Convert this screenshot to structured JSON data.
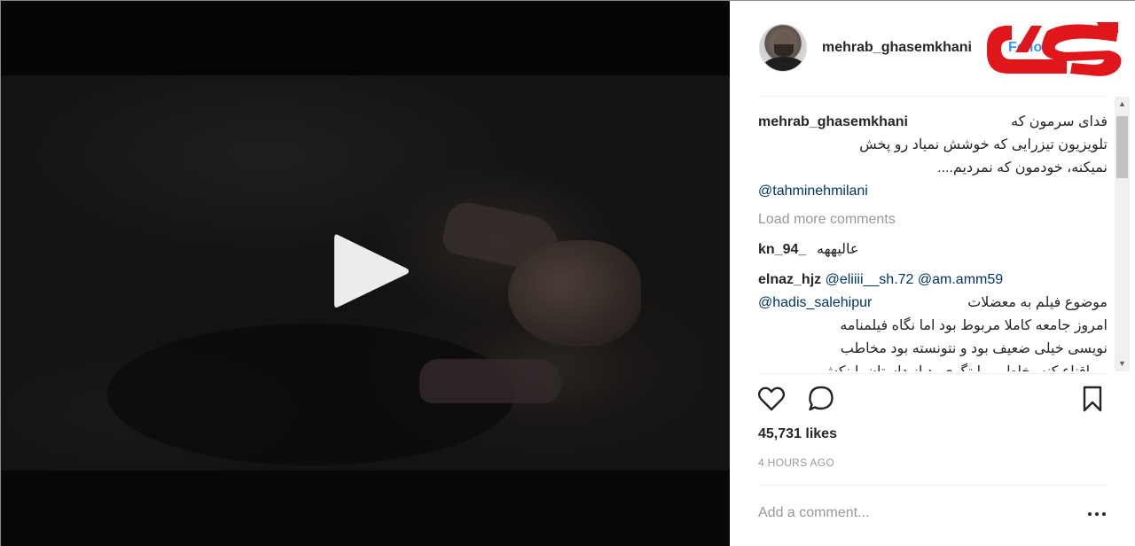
{
  "post": {
    "username": "mehrab_ghasemkhani",
    "follow_label": "Follow",
    "likes": "45,731 likes",
    "timestamp": "4 HOURS AGO",
    "add_comment_placeholder": "Add a comment..."
  },
  "caption": {
    "user": "mehrab_ghasemkhani",
    "line1": "فدای سرمون که",
    "line2": "تلویزیون تیزرایی که خوشش نمیاد رو پخش",
    "line3": "نمیکنه، خودمون که نمردیم....",
    "mention": "@tahminehmilani"
  },
  "load_more": "Load more comments",
  "comments": [
    {
      "user": "kn_94_",
      "text": "عالیههه"
    },
    {
      "user": "elnaz_hjz",
      "mentions": "@eliiii__sh.72 @am.amm59",
      "mention2": "@hadis_salehipur",
      "line1": "موضوع فیلم به معضلات",
      "line2": "امروز جامعه کاملا مربوط بود اما نگاه فیلمنامه",
      "line3": "نویسی خیلی ضعیف بود و نتونسته بود مخاطب",
      "line4": "رو اقناع کنه،بخاطر روایتگری بد از داستان. اینکش"
    }
  ],
  "icons": {
    "play": "play-icon",
    "like": "heart-icon",
    "comment": "comment-bubble-icon",
    "save": "bookmark-icon",
    "more": "more-options-icon"
  },
  "colors": {
    "link_blue": "#3897f0",
    "muted_gray": "#999999",
    "text": "#262626",
    "watermark_red": "#e0161b"
  }
}
